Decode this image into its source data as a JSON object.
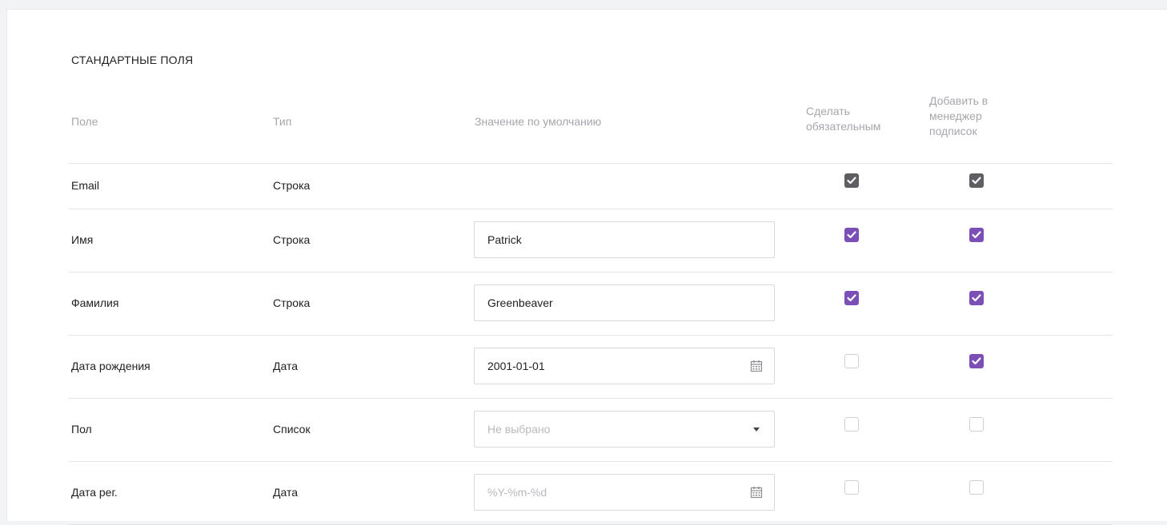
{
  "section_title": "СТАНДАРТНЫЕ ПОЛЯ",
  "columns": {
    "field": "Поле",
    "type": "Тип",
    "default": "Значение по умолчанию",
    "required": [
      "Сделать",
      "обязательным"
    ],
    "subscription": [
      "Добавить в",
      "менеджер",
      "подписок"
    ]
  },
  "rows": [
    {
      "field": "Email",
      "type": "Строка",
      "default_value": "",
      "placeholder": "",
      "input": "none",
      "required": true,
      "subscription": true,
      "locked": true
    },
    {
      "field": "Имя",
      "type": "Строка",
      "default_value": "Patrick",
      "placeholder": "",
      "input": "text",
      "required": true,
      "subscription": true,
      "locked": false
    },
    {
      "field": "Фамилия",
      "type": "Строка",
      "default_value": "Greenbeaver",
      "placeholder": "",
      "input": "text",
      "required": true,
      "subscription": true,
      "locked": false
    },
    {
      "field": "Дата рождения",
      "type": "Дата",
      "default_value": "2001-01-01",
      "placeholder": "",
      "input": "date",
      "required": false,
      "subscription": true,
      "locked": false
    },
    {
      "field": "Пол",
      "type": "Список",
      "default_value": "",
      "placeholder": "Не выбрано",
      "input": "select",
      "required": false,
      "subscription": false,
      "locked": false
    },
    {
      "field": "Дата рег.",
      "type": "Дата",
      "default_value": "",
      "placeholder": "%Y-%m-%d",
      "input": "date",
      "required": false,
      "subscription": false,
      "locked": false
    }
  ],
  "icons": {
    "calendar": "calendar-icon",
    "dropdown": "chevron-down-icon",
    "check": "checkmark-icon"
  },
  "colors": {
    "accent": "#7b4fb5",
    "locked": "#5f5f63",
    "header_text": "#a6a6ad",
    "border": "#e3e3e8"
  }
}
